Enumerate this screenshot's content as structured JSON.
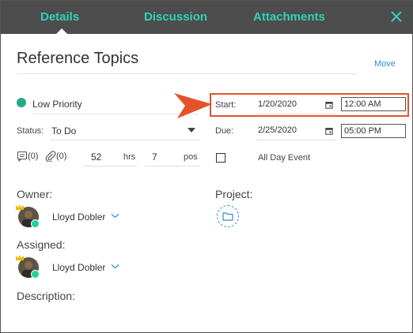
{
  "tabs": [
    {
      "label": "Details"
    },
    {
      "label": "Discussion"
    },
    {
      "label": "Attachments"
    }
  ],
  "title": "Reference Topics",
  "move_label": "Move",
  "priority": {
    "label": "Low Priority",
    "color": "#26a88c"
  },
  "status": {
    "label": "Status:",
    "value": "To Do"
  },
  "counts": {
    "comments": "(0)",
    "attachments": "(0)"
  },
  "estimate": {
    "hours": "52",
    "hours_unit": "hrs",
    "points": "7",
    "points_unit": "pos"
  },
  "start": {
    "label": "Start:",
    "date": "1/20/2020",
    "time": "12:00 AM"
  },
  "due": {
    "label": "Due:",
    "date": "2/25/2020",
    "time": "05:00 PM"
  },
  "all_day_label": "All Day Event",
  "owner": {
    "label": "Owner:",
    "name": "Lloyd Dobler"
  },
  "project_label": "Project:",
  "assigned": {
    "label": "Assigned:",
    "name": "Lloyd Dobler"
  },
  "description_label": "Description:",
  "colors": {
    "header_bg": "#4d4d4d",
    "tab_text": "#2ed3b7",
    "highlight": "#e4532a",
    "link": "#2f8fce",
    "online": "#1fd3a0"
  },
  "icons": [
    "close-icon",
    "comment-icon",
    "paperclip-icon",
    "calendar-icon",
    "caret-down-icon",
    "chevron-down-icon",
    "folder-icon",
    "crown-icon",
    "arrow-pointer-icon"
  ]
}
